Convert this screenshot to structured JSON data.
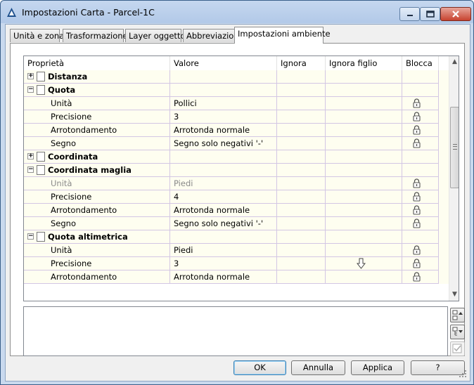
{
  "window": {
    "title": "Impostazioni Carta - Parcel-1C"
  },
  "tabs": [
    {
      "label": "Unità e zona"
    },
    {
      "label": "Trasformazione"
    },
    {
      "label": "Layer oggetto"
    },
    {
      "label": "Abbreviazioni"
    },
    {
      "label": "Impostazioni ambiente",
      "active": true
    }
  ],
  "grid": {
    "columns": [
      "Proprietà",
      "Valore",
      "Ignora",
      "Ignora figlio",
      "Blocca"
    ],
    "rows": [
      {
        "kind": "group",
        "expander": "+",
        "label": "Distanza"
      },
      {
        "kind": "group",
        "expander": "−",
        "label": "Quota"
      },
      {
        "kind": "prop",
        "label": "Unità",
        "value": "Pollici",
        "lock": true
      },
      {
        "kind": "prop",
        "label": "Precisione",
        "value": "3",
        "lock": true
      },
      {
        "kind": "prop",
        "label": "Arrotondamento",
        "value": "Arrotonda normale",
        "lock": true
      },
      {
        "kind": "prop",
        "label": "Segno",
        "value": "Segno solo negativi '-'",
        "lock": true
      },
      {
        "kind": "group",
        "expander": "+",
        "label": "Coordinata"
      },
      {
        "kind": "group",
        "expander": "−",
        "label": "Coordinata maglia"
      },
      {
        "kind": "prop",
        "label": "Unità",
        "value": "Piedi",
        "lock": true,
        "disabled": true
      },
      {
        "kind": "prop",
        "label": "Precisione",
        "value": "4",
        "lock": true
      },
      {
        "kind": "prop",
        "label": "Arrotondamento",
        "value": "Arrotonda normale",
        "lock": true
      },
      {
        "kind": "prop",
        "label": "Segno",
        "value": "Segno solo negativi '-'",
        "lock": true
      },
      {
        "kind": "group",
        "expander": "−",
        "label": "Quota altimetrica"
      },
      {
        "kind": "prop",
        "label": "Unità",
        "value": "Piedi",
        "lock": true
      },
      {
        "kind": "prop",
        "label": "Precisione",
        "value": "3",
        "lock": true,
        "override_arrow": true
      },
      {
        "kind": "prop",
        "label": "Arrotondamento",
        "value": "Arrotonda normale",
        "lock": true
      }
    ]
  },
  "buttons": {
    "ok": "OK",
    "cancel": "Annulla",
    "apply": "Applica",
    "help": "?"
  },
  "colors": {
    "row_bg": "#fefef0",
    "grid_line": "#d3c6e4",
    "title_bar": "#c5d7ef"
  }
}
